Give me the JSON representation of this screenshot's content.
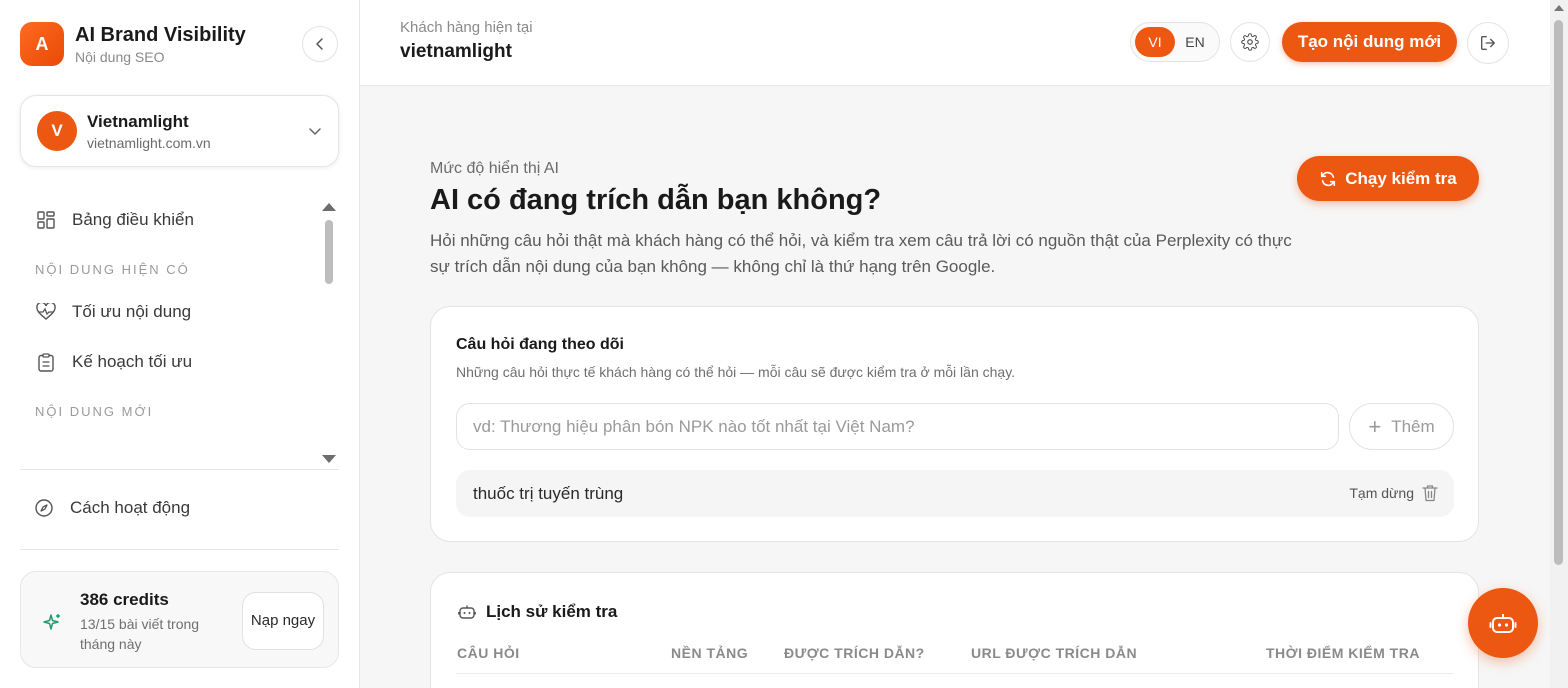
{
  "brand": {
    "logo_letter": "A",
    "title": "AI Brand Visibility",
    "subtitle": "Nội dung SEO"
  },
  "site": {
    "avatar_letter": "V",
    "name": "Vietnamlight",
    "domain": "vietnamlight.com.vn"
  },
  "sidebar": {
    "dashboard_label": "Bảng điều khiển",
    "section_existing": "NỘI DUNG HIỆN CÓ",
    "optimize_label": "Tối ưu nội dung",
    "plan_label": "Kế hoạch tối ưu",
    "section_new": "NỘI DUNG MỚI",
    "how_label": "Cách hoạt động"
  },
  "credits": {
    "amount": "386 credits",
    "usage": "13/15 bài viết trong tháng này",
    "topup_label": "Nạp ngay"
  },
  "header": {
    "client_label": "Khách hàng hiện tại",
    "client_name": "vietnamlight",
    "lang_vi": "VI",
    "lang_en": "EN",
    "new_content_label": "Tạo nội dung mới"
  },
  "main": {
    "eyebrow": "Mức độ hiển thị AI",
    "title": "AI có đang trích dẫn bạn không?",
    "description": "Hỏi những câu hỏi thật mà khách hàng có thể hỏi, và kiểm tra xem câu trả lời có nguồn thật của Perplexity có thực sự trích dẫn nội dung của bạn không — không chỉ là thứ hạng trên Google.",
    "run_label": "Chạy kiểm tra"
  },
  "tracked": {
    "title": "Câu hỏi đang theo dõi",
    "subtitle": "Những câu hỏi thực tế khách hàng có thể hỏi — mỗi câu sẽ được kiểm tra ở mỗi lần chạy.",
    "input_placeholder": "vd: Thương hiệu phân bón NPK nào tốt nhất tại Việt Nam?",
    "input_value": "",
    "add_label": "Thêm",
    "questions": [
      {
        "text": "thuốc trị tuyến trùng",
        "status": "Tạm dừng"
      }
    ]
  },
  "history": {
    "title": "Lịch sử kiểm tra",
    "columns": [
      "CÂU HỎI",
      "NỀN TẢNG",
      "ĐƯỢC TRÍCH DẪN?",
      "URL ĐƯỢC TRÍCH DẪN",
      "THỜI ĐIỂM KIỂM TRA"
    ]
  },
  "colors": {
    "accent": "#ec5712",
    "background": "#f6f6f6"
  },
  "icons": {
    "collapse": "chevron-left-icon",
    "site_dropdown": "chevron-down-icon",
    "dashboard": "grid-icon",
    "optimize": "heart-pulse-icon",
    "plan": "clipboard-icon",
    "how": "compass-icon",
    "credits": "sparkle-icon",
    "settings": "gear-icon",
    "logout": "logout-icon",
    "run": "refresh-icon",
    "add": "plus-icon",
    "delete": "trash-icon",
    "history": "robot-icon",
    "fab": "robot-icon"
  }
}
